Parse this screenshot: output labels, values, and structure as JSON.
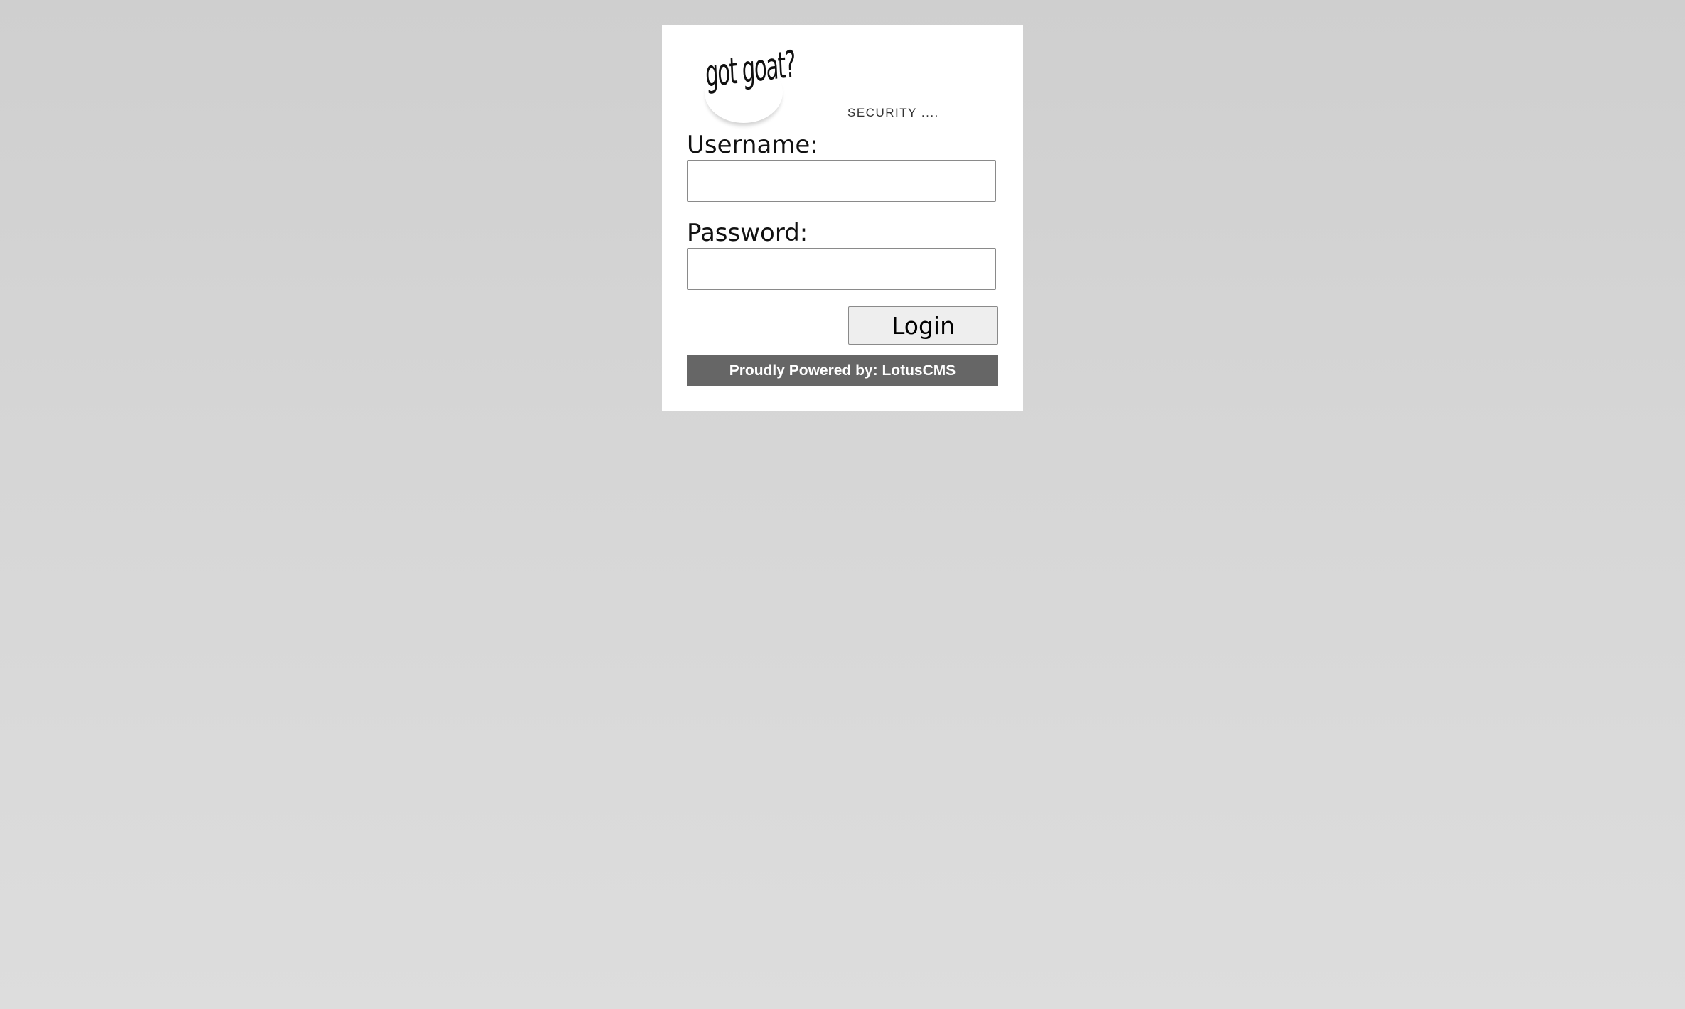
{
  "header": {
    "logo_text": "got goat?",
    "tagline": "SECURITY ...."
  },
  "form": {
    "username_label": "Username:",
    "username_value": "",
    "password_label": "Password:",
    "password_value": "",
    "login_label": "Login"
  },
  "footer": {
    "powered_by": "Proudly Powered by: LotusCMS"
  }
}
